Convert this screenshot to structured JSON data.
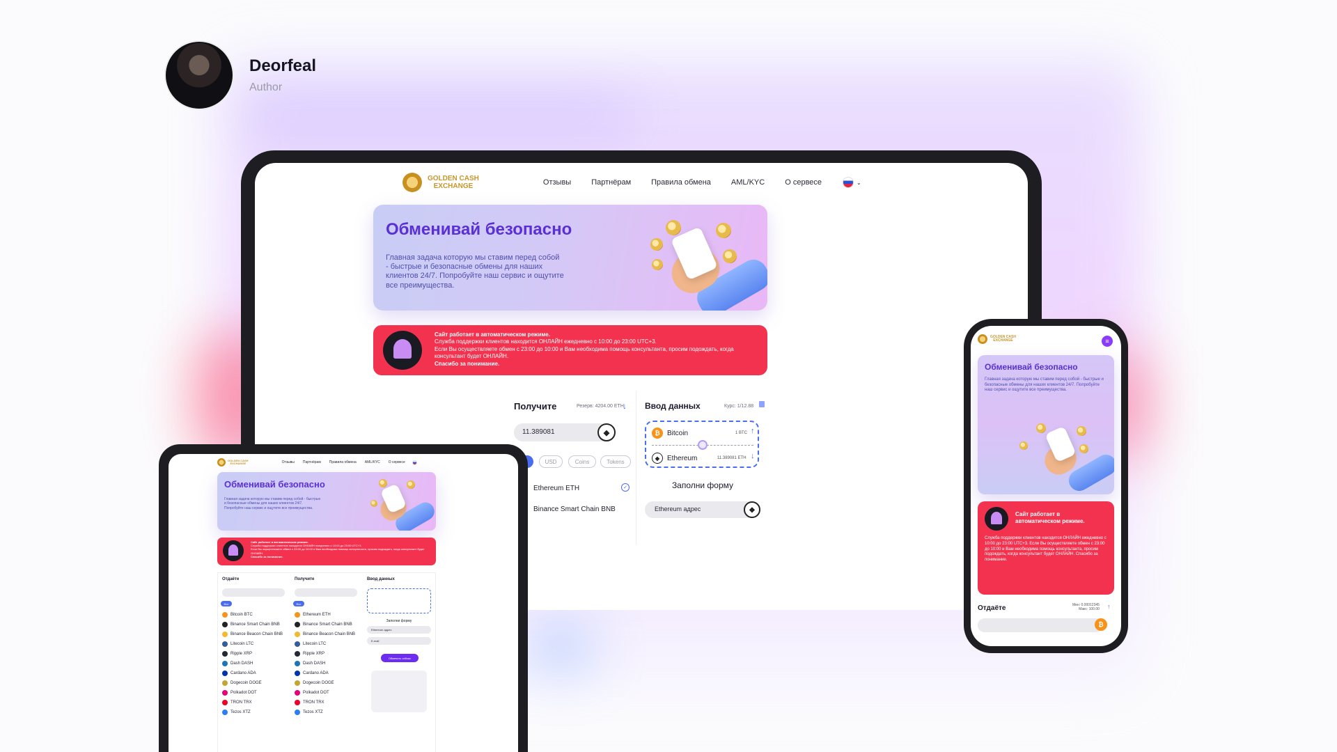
{
  "author": {
    "name": "Deorfeal",
    "role": "Author"
  },
  "brand": {
    "line1": "GOLDEN CASH",
    "line2": "EXCHANGE"
  },
  "nav": {
    "items": [
      "Отзывы",
      "Партнёрам",
      "Правила обмена",
      "AML/KYC",
      "О сервесе"
    ]
  },
  "hero": {
    "title": "Обменивай безопасно",
    "text": "Главная задача которую мы ставим перед собой - быстрые и безопасные обмены для наших клиентов 24/7. Попробуйте наш сервис и ощутите все преимущества."
  },
  "alert": {
    "headline": "Сайт работает в автоматическом режиме.",
    "line1": "Служба поддержки клиентов находится ОНЛАЙН ежедневно с 10:00 до 23:00 UTC+3.",
    "line2": "Если Вы осуществляете обмен с 23:00 до 10:00 и Вам необходима помощь консультанта, просим подождать, когда консультант будет ОНЛАЙН.",
    "thanks": "Спасибо за понимание."
  },
  "give": {
    "amount_partial": "12345",
    "amount_partial2": "00.00"
  },
  "receive": {
    "title": "Получите",
    "reserve": "Резерв: 4204.00 ETH",
    "amount": "11.389081",
    "filters": [
      "Все",
      "USD",
      "Coins",
      "Tokens"
    ],
    "coins": [
      "Ethereum ETH",
      "Binance Smart Chain BNB"
    ]
  },
  "data_entry": {
    "title": "Ввод данных",
    "rate": "Курс: 1/12.88",
    "from": {
      "name": "Bitcoin",
      "amount": "1 BTC"
    },
    "to": {
      "name": "Ethereum",
      "amount": "11.389081 ETH"
    },
    "form_title": "Заполни форму",
    "address_placeholder": "Ethereum адрес"
  },
  "give_partial": {
    "filter": "Tokens",
    "coin_end": "B"
  },
  "tablet": {
    "give_title": "Отдаёте",
    "receive_title": "Получите",
    "data_title": "Ввод данных",
    "list_left": [
      "Bitcoin BTC",
      "Binance Smart Chain BNB",
      "Binance Beacon Chain BNB",
      "Litecoin LTC",
      "Ripple XRP",
      "Dash DASH",
      "Cardano ADA",
      "Dogecoin DOGE",
      "Polkadot DOT",
      "TRON TRX",
      "Tezos XTZ"
    ],
    "list_right": [
      "Ethereum ETH",
      "Binance Smart Chain BNB",
      "Binance Beacon Chain BNB",
      "Litecoin LTC",
      "Ripple XRP",
      "Dash DASH",
      "Cardano ADA",
      "Dogecoin DOGE",
      "Polkadot DOT",
      "TRON TRX",
      "Tezos XTZ"
    ],
    "form_title": "Заполни форму",
    "address": "Ethereum адрес",
    "email": "E-mail",
    "submit": "Обменять сейчас"
  },
  "phone": {
    "title": "Обменивай безопасно",
    "alert_head": "Сайт работает в автоматическом режиме.",
    "alert_body": "Служба поддержки клиентов находится ОНЛАЙН ежедневно с 10:00 до 23:00 UTC+3. Если Вы осуществляете обмен с 23:00 до 10:00 и Вам необходима помощь консультанта, просим подождать, когда консультант будет ОНЛАЙН. Спасибо за понимание.",
    "give_title": "Отдаёте",
    "min": "Мин: 0.00012345",
    "max": "Макс: 100.00"
  },
  "colors": {
    "accent": "#4a6cf0",
    "alert": "#f3324f",
    "brand": "#c9962b",
    "title": "#5a2fd6"
  }
}
